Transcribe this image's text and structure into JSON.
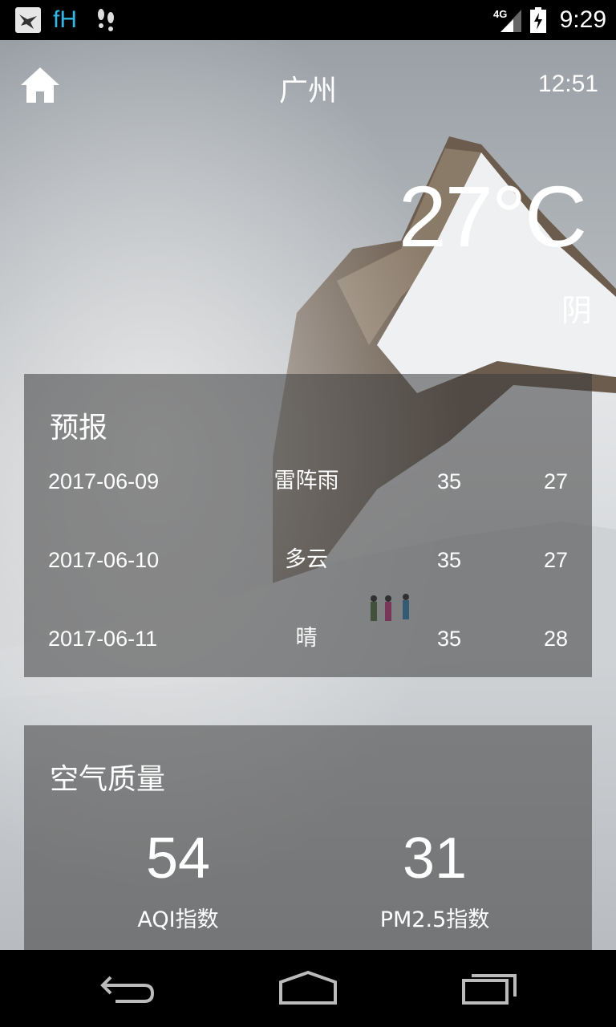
{
  "status_bar": {
    "time": "9:29",
    "notif_app": "fH",
    "network_label": "4G",
    "icons": [
      "bird-notification-icon",
      "fh-notification-icon",
      "footprints-icon",
      "signal-4g-icon",
      "battery-charging-icon"
    ]
  },
  "header": {
    "city": "广州",
    "update_time": "12:51",
    "home_icon": "home-icon"
  },
  "now": {
    "temperature": "27°C",
    "condition": "阴"
  },
  "forecast": {
    "title": "预报",
    "rows": [
      {
        "date": "2017-06-09",
        "condition": "雷阵雨",
        "max": "35",
        "min": "27"
      },
      {
        "date": "2017-06-10",
        "condition": "多云",
        "max": "35",
        "min": "27"
      },
      {
        "date": "2017-06-11",
        "condition": "晴",
        "max": "35",
        "min": "28"
      }
    ]
  },
  "air_quality": {
    "title": "空气质量",
    "aqi_value": "54",
    "aqi_label": "AQI指数",
    "pm25_value": "31",
    "pm25_label": "PM2.5指数"
  },
  "nav_bar": {
    "icons": [
      "back-icon",
      "home-nav-icon",
      "recent-apps-icon"
    ]
  },
  "colors": {
    "status_bar": "#000000",
    "accent_fh": "#33b5e5",
    "card_bg": "rgba(60,60,60,0.55)",
    "text": "#ffffff"
  }
}
